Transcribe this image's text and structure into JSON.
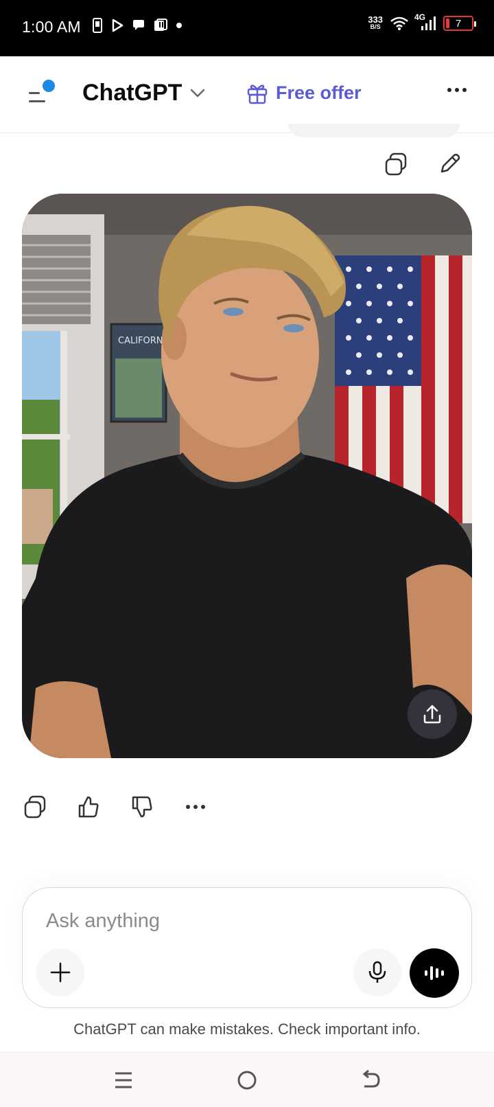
{
  "status_bar": {
    "time": "1:00 AM",
    "net_speed_value": "333",
    "net_speed_unit": "B/S",
    "network": "4G",
    "battery": "7"
  },
  "header": {
    "title": "ChatGPT",
    "offer_label": "Free offer",
    "accent_color": "#5b5bd6",
    "notification_dot_color": "#1e88e5"
  },
  "image": {
    "poster_text": "CALIFORNIA"
  },
  "composer": {
    "placeholder": "Ask anything"
  },
  "disclaimer": "ChatGPT can make mistakes. Check important info."
}
